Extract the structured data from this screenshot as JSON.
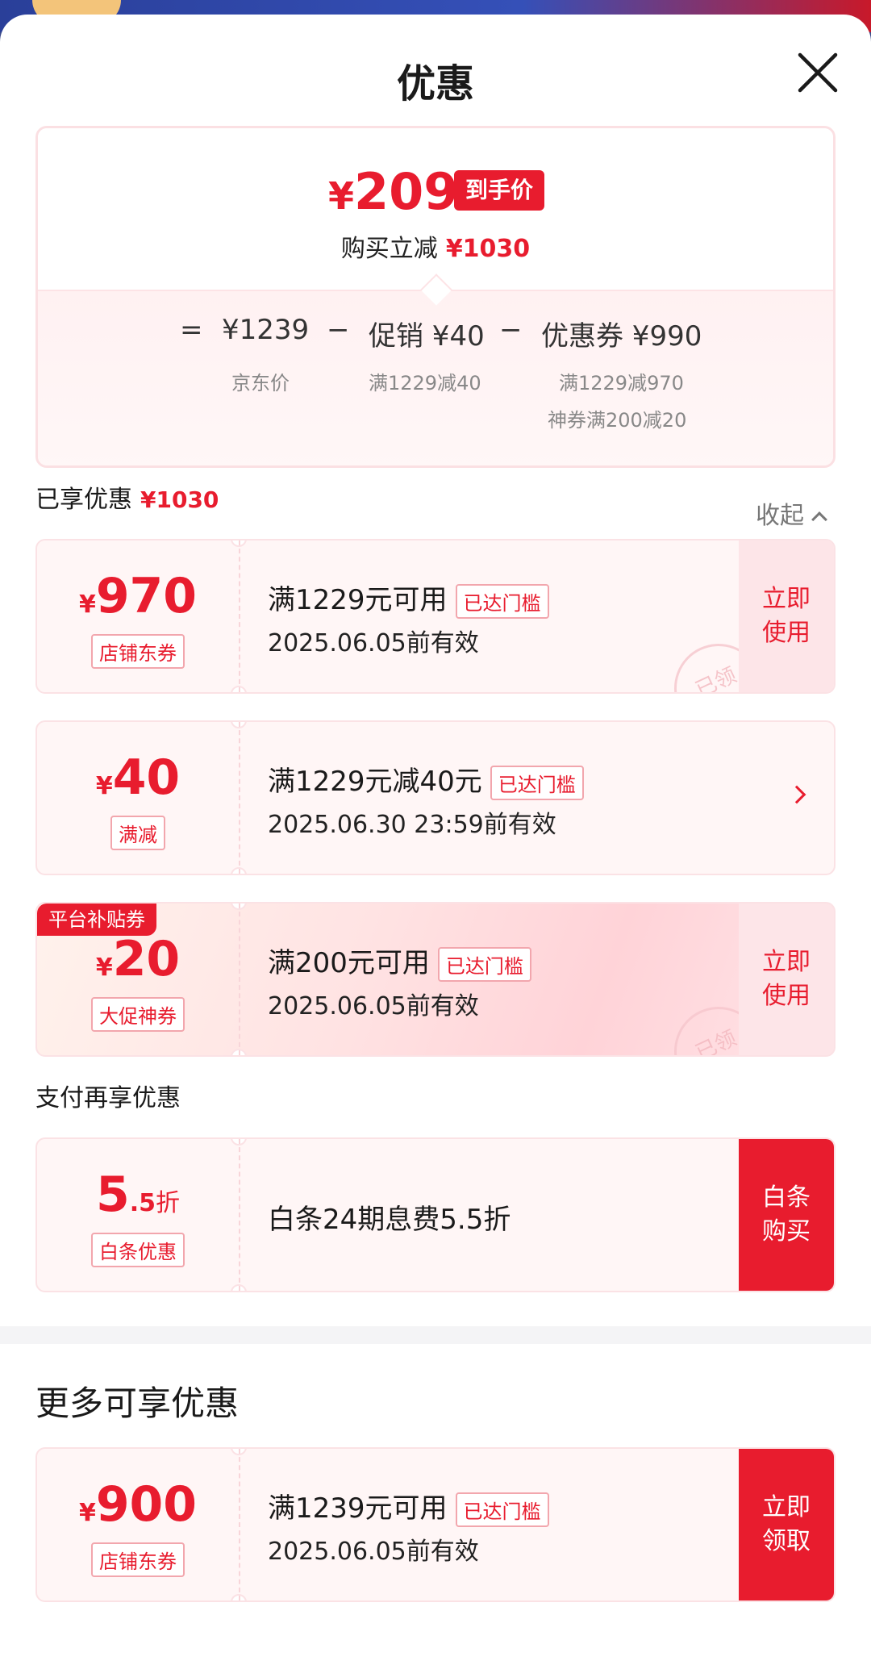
{
  "sheet": {
    "title": "优惠"
  },
  "summary": {
    "currency": "¥",
    "final_price": "209",
    "final_tag": "到手价",
    "save_label": "购买立减",
    "save_amount": "¥1030",
    "calc": {
      "eq": "=",
      "base": "¥1239",
      "base_label": "京东价",
      "minus1": "−",
      "promo": "促销 ¥40",
      "promo_sub": "满1229减40",
      "minus2": "−",
      "coupon": "优惠券 ¥990",
      "coupon_sub1": "满1229减970",
      "coupon_sub2": "神券满200减20"
    }
  },
  "enjoyed": {
    "label": "已享优惠",
    "amount": "¥1030",
    "collapse_label": "收起"
  },
  "coupons": [
    {
      "currency": "¥",
      "amount": "970",
      "type": "店铺东券",
      "condition": "满1229元可用",
      "reached": "已达门槛",
      "expiry": "2025.06.05前有效",
      "action": "立即\n使用",
      "stamp": "已领"
    },
    {
      "currency": "¥",
      "amount": "40",
      "type": "满减",
      "condition": "满1229元减40元",
      "reached": "已达门槛",
      "expiry": "2025.06.30 23:59前有效"
    },
    {
      "platform_tag": "平台补贴券",
      "currency": "¥",
      "amount": "20",
      "type": "大促神券",
      "condition": "满200元可用",
      "reached": "已达门槛",
      "expiry": "2025.06.05前有效",
      "action": "立即\n使用",
      "stamp": "已领"
    }
  ],
  "payment": {
    "title": "支付再享优惠",
    "discount_main": "5",
    "discount_decimal": ".5",
    "discount_unit": "折",
    "type": "白条优惠",
    "desc": "白条24期息费5.5折",
    "action": "白条\n购买"
  },
  "more": {
    "title": "更多可享优惠",
    "coupon": {
      "currency": "¥",
      "amount": "900",
      "type": "店铺东券",
      "condition": "满1239元可用",
      "reached": "已达门槛",
      "expiry": "2025.06.05前有效",
      "action": "立即\n领取"
    }
  },
  "colors": {
    "accent": "#e81c2e",
    "card_bg": "#fff6f6",
    "border": "#fbe2e5"
  }
}
